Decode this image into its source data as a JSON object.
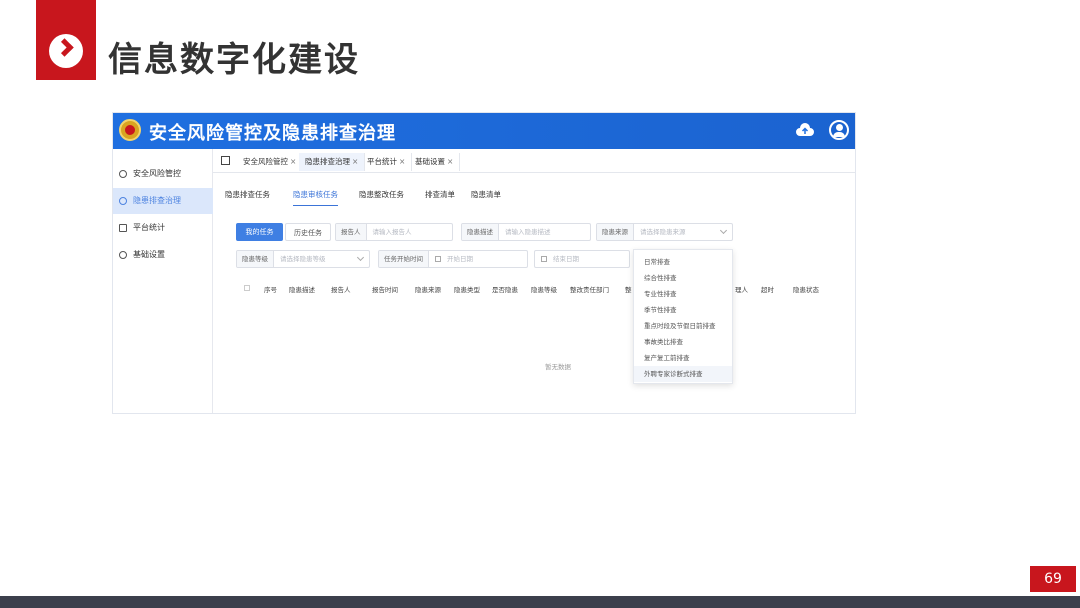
{
  "slide": {
    "title": "信息数字化建设",
    "page_number": "69",
    "accent_color": "#c8161d"
  },
  "app": {
    "title": "安全风险管控及隐患排查治理",
    "header_color": "#1f6fe0",
    "header_icons": [
      "emblem-icon",
      "cloud-upload-icon",
      "user-icon"
    ]
  },
  "sidebar": {
    "items": [
      {
        "label": "安全风险管控",
        "icon": "database-icon",
        "active": false
      },
      {
        "label": "隐患排查治理",
        "icon": "search-icon",
        "active": true
      },
      {
        "label": "平台统计",
        "icon": "monitor-icon",
        "active": false
      },
      {
        "label": "基础设置",
        "icon": "gear-icon",
        "active": false
      }
    ]
  },
  "tabs": [
    {
      "label": "安全风险管控",
      "close": "×"
    },
    {
      "label": "隐患排查治理",
      "close": "×",
      "active": true
    },
    {
      "label": "平台统计",
      "close": "×"
    },
    {
      "label": "基础设置",
      "close": "×"
    }
  ],
  "subtabs": [
    "隐患排查任务",
    "隐患审核任务",
    "隐患整改任务",
    "排查清单",
    "隐患清单"
  ],
  "filters": {
    "my_tasks": "我的任务",
    "history_tasks": "历史任务",
    "reporter": {
      "label": "报告人",
      "placeholder": "请输入报告人"
    },
    "description": {
      "label": "隐患描述",
      "placeholder": "请输入隐患描述"
    },
    "source": {
      "label": "隐患来源",
      "placeholder": "请选择隐患来源"
    },
    "level": {
      "label": "隐患等级",
      "placeholder": "请选择隐患等级"
    },
    "start_time": {
      "label": "任务开始时间",
      "start_placeholder": "开始日期",
      "end_placeholder": "结束日期"
    }
  },
  "table": {
    "headers": [
      "序号",
      "隐患描述",
      "报告人",
      "报告时间",
      "隐患来源",
      "隐患类型",
      "是否隐患",
      "隐患等级",
      "整改责任部门",
      "整",
      "理人",
      "超时",
      "隐患状态"
    ],
    "empty_text": "暂无数据"
  },
  "source_dropdown": {
    "options": [
      "日常排查",
      "综合性排查",
      "专业性排查",
      "季节性排查",
      "重点时段及节假日前排查",
      "事故类比排查",
      "复产复工前排查",
      "外聘专家诊断式排查"
    ],
    "hovered_index": 7
  }
}
